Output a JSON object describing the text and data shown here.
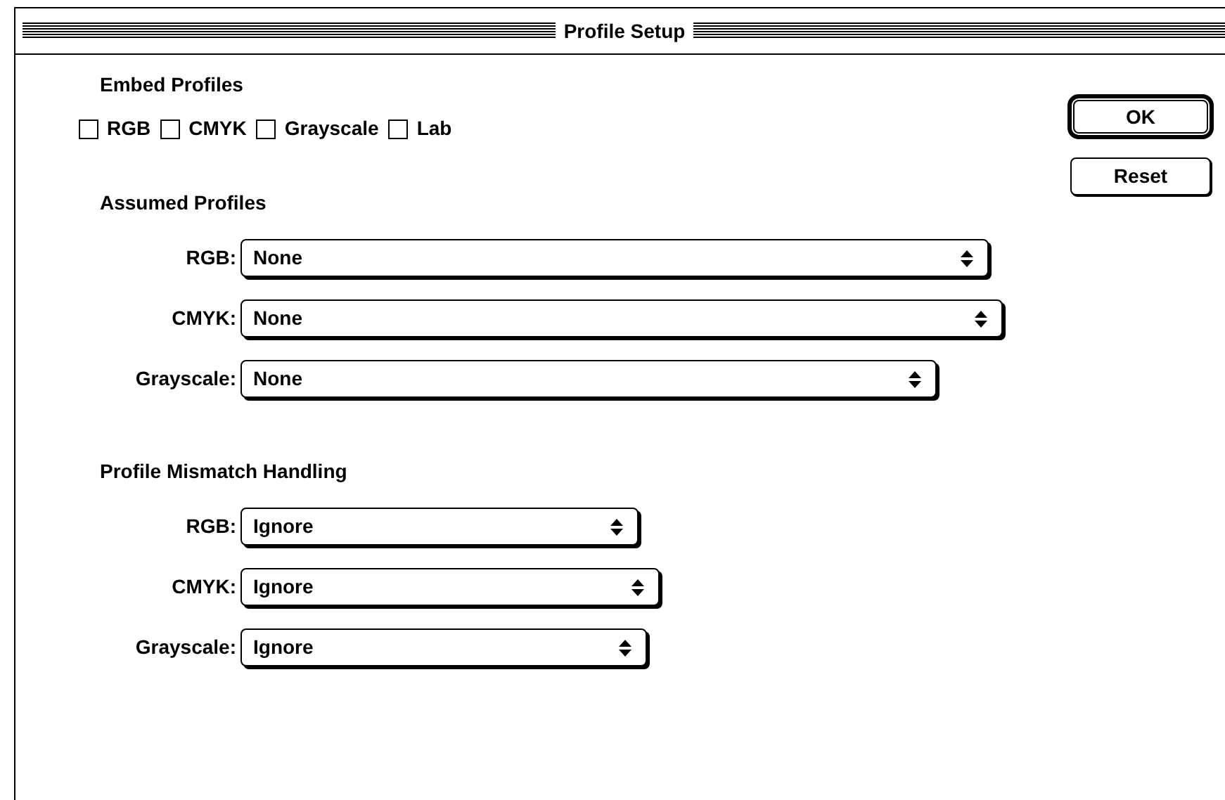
{
  "window": {
    "title": "Profile Setup"
  },
  "embed_profiles": {
    "heading": "Embed Profiles",
    "options": [
      {
        "label": "RGB",
        "checked": false
      },
      {
        "label": "CMYK",
        "checked": false
      },
      {
        "label": "Grayscale",
        "checked": false
      },
      {
        "label": "Lab",
        "checked": false
      }
    ]
  },
  "buttons": [
    {
      "label": "OK",
      "default": true
    },
    {
      "label": "Reset",
      "default": false
    }
  ],
  "assumed_profiles": {
    "heading": "Assumed Profiles",
    "rows": [
      {
        "label": "RGB:",
        "value": "None"
      },
      {
        "label": "CMYK:",
        "value": "None"
      },
      {
        "label": "Grayscale:",
        "value": "None"
      }
    ]
  },
  "mismatch_handling": {
    "heading": "Profile Mismatch Handling",
    "rows": [
      {
        "label": "RGB:",
        "value": "Ignore"
      },
      {
        "label": "CMYK:",
        "value": "Ignore"
      },
      {
        "label": "Grayscale:",
        "value": "Ignore"
      }
    ]
  }
}
